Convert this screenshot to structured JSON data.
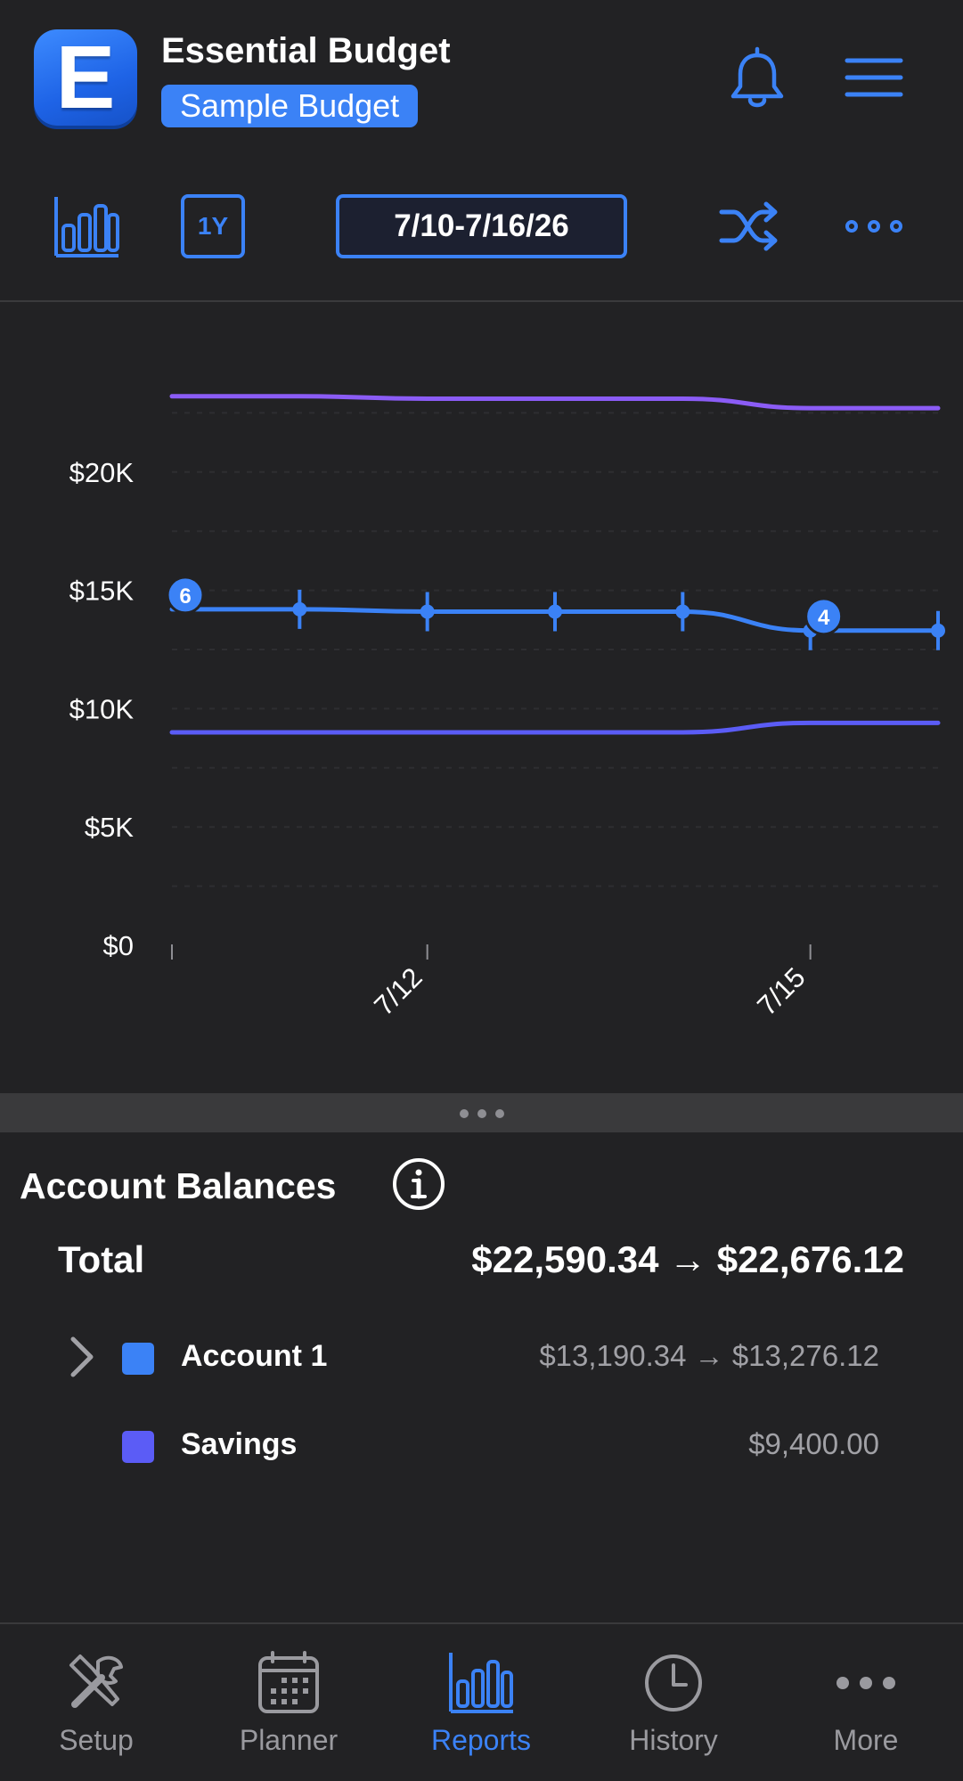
{
  "colors": {
    "accent": "#3b82f6",
    "background": "#222224",
    "total_series": "#8b5cf6",
    "account1_series": "#3b82f6",
    "savings_series": "#5b5cf6"
  },
  "header": {
    "logo_letter": "E",
    "app_title": "Essential Budget",
    "budget_name": "Sample Budget",
    "icons": [
      "bell-icon",
      "menu-icon"
    ]
  },
  "toolbar": {
    "range_label": "1Y",
    "date_range": "7/10-7/16/26",
    "icons": [
      "chart-type-icon",
      "shuffle-icon",
      "more-icon"
    ]
  },
  "chart_data": {
    "type": "line",
    "x": [
      "7/10",
      "7/11",
      "7/12",
      "7/13",
      "7/14",
      "7/15",
      "7/16"
    ],
    "x_tick_labels": [
      "7/12",
      "7/15"
    ],
    "y_tick_labels": [
      "$0",
      "$5K",
      "$10K",
      "$15K",
      "$20K"
    ],
    "ylim": [
      0,
      25000
    ],
    "grid": true,
    "series": [
      {
        "values": [
          23200,
          23200,
          23100,
          23100,
          23100,
          22700,
          22700
        ]
      },
      {
        "values": [
          14200,
          14200,
          14100,
          14100,
          14100,
          13300,
          13300
        ]
      },
      {
        "values": [
          9000,
          9000,
          9000,
          9000,
          9000,
          9400,
          9400
        ]
      }
    ],
    "annotations": [
      {
        "x": "7/10",
        "y": 14800,
        "label": "6"
      },
      {
        "x": "7/15",
        "y": 13900,
        "label": "4"
      }
    ]
  },
  "balances": {
    "title": "Account Balances",
    "total_label": "Total",
    "total_value": "$22,590.34 → $22,676.12",
    "accounts": [
      {
        "name": "Account 1",
        "value": "$13,190.34 → $13,276.12",
        "color": "#3b82f6",
        "expandable": true
      },
      {
        "name": "Savings",
        "value": "$9,400.00",
        "color": "#5b5cf6",
        "expandable": false
      }
    ]
  },
  "tabs": [
    {
      "label": "Setup",
      "icon": "tools-icon",
      "active": false
    },
    {
      "label": "Planner",
      "icon": "calendar-icon",
      "active": false
    },
    {
      "label": "Reports",
      "icon": "bar-chart-icon",
      "active": true
    },
    {
      "label": "History",
      "icon": "clock-icon",
      "active": false
    },
    {
      "label": "More",
      "icon": "more-icon",
      "active": false
    }
  ]
}
